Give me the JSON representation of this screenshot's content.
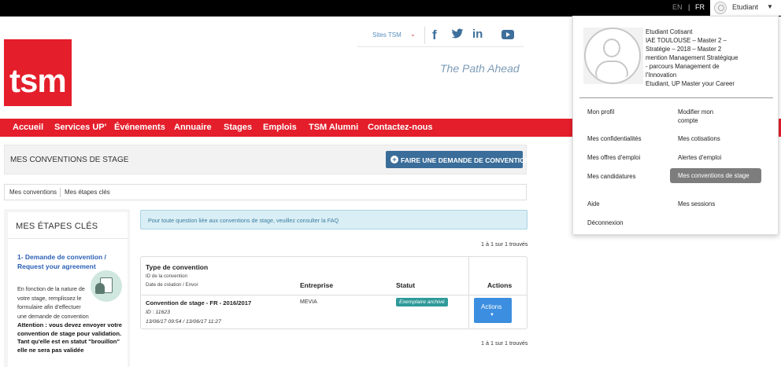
{
  "topbar": {
    "lang_en": "EN",
    "lang_sep": "|",
    "lang_fr": "FR",
    "user_label": "Etudiant",
    "caret": "▼"
  },
  "logo": {
    "text": "tsm"
  },
  "social": {
    "sites_label": "Sites TSM",
    "sites_caret": "⌄",
    "facebook": "f",
    "linkedin": "in"
  },
  "tagline": "The Path Ahead",
  "nav": {
    "items": [
      "Accueil",
      "Services UP'",
      "Événements",
      "Annuaire",
      "Stages",
      "Emplois",
      "TSM Alumni",
      "Contactez-nous"
    ]
  },
  "page": {
    "title": "MES CONVENTIONS DE STAGE",
    "new_button": "FAIRE UNE DEMANDE DE CONVENTION",
    "plus": "+",
    "tabs": [
      "Mes conventions",
      "Mes étapes clés"
    ]
  },
  "sidebar": {
    "title": "MES ÉTAPES CLÉS",
    "step_title": "1- Demande de convention / Request your agreement",
    "step_desc": "En fonction de la nature de votre stage, remplissez le formulaire afin d'effectuer une demande de convention",
    "step_warning": "Attention : vous devez envoyer votre convention de stage pour validation. Tant qu'elle est en statut \"brouillon\" elle ne sera pas validée"
  },
  "info_message": "Pour toute question liée aux conventions de stage, veuillez consulter la FAQ",
  "pagination": {
    "top": "1 à 1 sur 1 trouvés",
    "bottom": "1 à 1 sur 1 trouvés"
  },
  "table": {
    "headers": {
      "type": "Type de convention",
      "type_sub1": "ID de la convention",
      "type_sub2": "Date de création / Envoi",
      "entreprise": "Entreprise",
      "statut": "Statut",
      "actions": "Actions"
    },
    "rows": [
      {
        "type": "Convention de stage - FR - 2016/2017",
        "id": "ID : 11623",
        "dates": "13/06/17 09:54 / 13/06/17 11:27",
        "entreprise": "MEVIA",
        "statut": "Exemplaire archivé",
        "action_label": "Actions",
        "action_caret": "▼"
      }
    ]
  },
  "user_menu": {
    "info_lines": [
      "Etudiant Cotisant",
      "IAE TOULOUSE – Master 2 –",
      "Stratégie – 2018 – Master 2",
      "mention Management Stratégique",
      "- parcours Management de",
      "l'Innovation",
      "Etudiant, UP Master your Career"
    ],
    "items_left": [
      "Mon profil",
      "Mes confidentialités",
      "Mes offres d'emploi",
      "Mes candidatures",
      "Aide",
      "Déconnexion"
    ],
    "items_right": [
      "Modifier mon compte",
      "Mes cotisations",
      "Alertes d'emploi",
      "Mes conventions de stage",
      "Mes sessions"
    ]
  },
  "colors": {
    "brand_red": "#e41e2b",
    "primary_button": "#3a6d99",
    "action_button": "#3c8ee0",
    "badge": "#2f9a9a",
    "info_bg": "#d9eef5"
  },
  "icons": [
    "user-avatar-icon",
    "facebook-icon",
    "twitter-icon",
    "linkedin-icon",
    "youtube-icon",
    "plus-circle-icon",
    "chevron-down-icon",
    "agreement-illustration-icon"
  ]
}
